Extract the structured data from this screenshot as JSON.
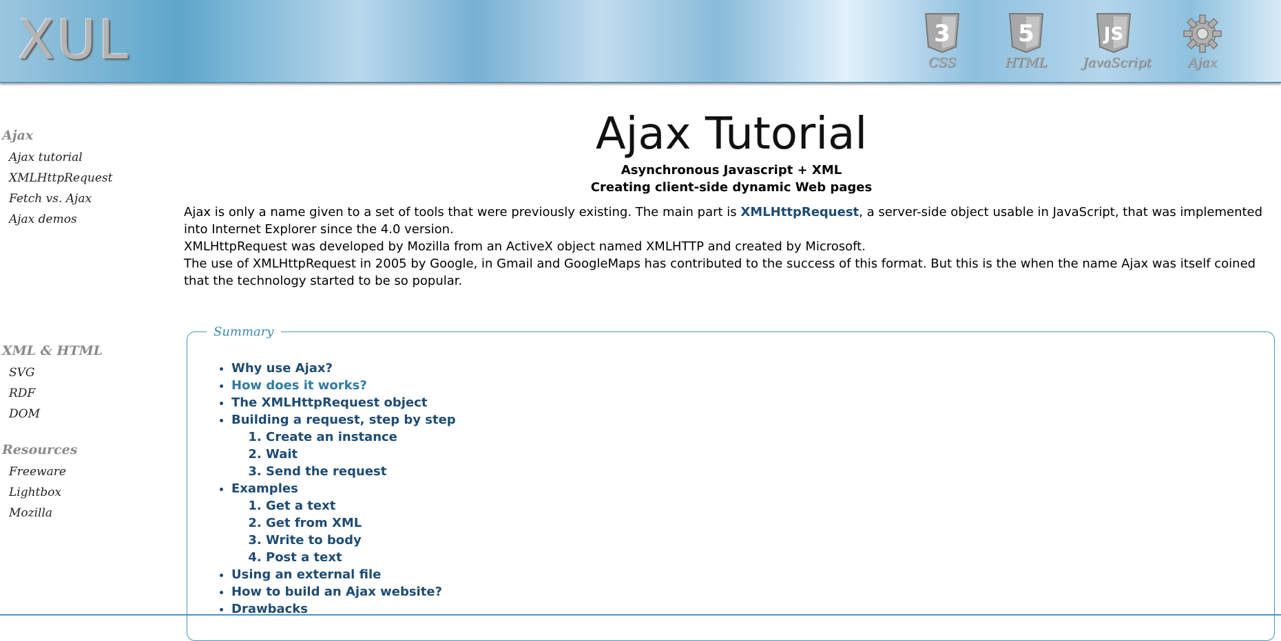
{
  "header": {
    "logo": "XUL",
    "nav": [
      {
        "label": "CSS",
        "icon": "css3-shield-icon"
      },
      {
        "label": "HTML",
        "icon": "html5-shield-icon"
      },
      {
        "label": "JavaScript",
        "icon": "js-shield-icon"
      },
      {
        "label": "Ajax",
        "icon": "gear-icon"
      }
    ]
  },
  "sidebar": {
    "groups": [
      {
        "title": "Ajax",
        "items": [
          "Ajax tutorial",
          "XMLHttpRequest",
          "Fetch vs. Ajax",
          "Ajax demos"
        ]
      },
      {
        "title": "XML & HTML",
        "items": [
          "SVG",
          "RDF",
          "DOM"
        ]
      },
      {
        "title": "Resources",
        "items": [
          "Freeware",
          "Lightbox",
          "Mozilla"
        ]
      }
    ]
  },
  "main": {
    "title": "Ajax Tutorial",
    "subtitle1": "Asynchronous Javascript + XML",
    "subtitle2": "Creating client-side dynamic Web pages",
    "intro": {
      "p1_before": "Ajax is only a name given to a set of tools that were previously existing. The main part is ",
      "p1_link": "XMLHttpRequest",
      "p1_after": ", a server-side object usable in JavaScript, that was implemented into Internet Explorer since the 4.0 version.",
      "p2": "XMLHttpRequest was developed by Mozilla from an ActiveX object named XMLHTTP and created by Microsoft.",
      "p3": "The use of XMLHttpRequest in 2005 by Google, in Gmail and GoogleMaps has contributed to the success of this format. But this is the when the name Ajax was itself coined that the technology started to be so popular."
    },
    "summary": {
      "legend": "Summary",
      "items": [
        "Why use Ajax?",
        "How does it works?",
        "The XMLHttpRequest object",
        "Building a request, step by step",
        "Create an instance",
        "Wait",
        "Send the request",
        "Examples",
        "Get a text",
        "Get from XML",
        "Write to body",
        "Post a text",
        "Using an external file",
        "How to build an Ajax website?",
        "Drawbacks"
      ]
    }
  },
  "colors": {
    "link": "#1d4b74",
    "link_active": "#2f7aa5",
    "summary_border": "#4a94bd",
    "sidebar_title": "#8a8a8a"
  }
}
